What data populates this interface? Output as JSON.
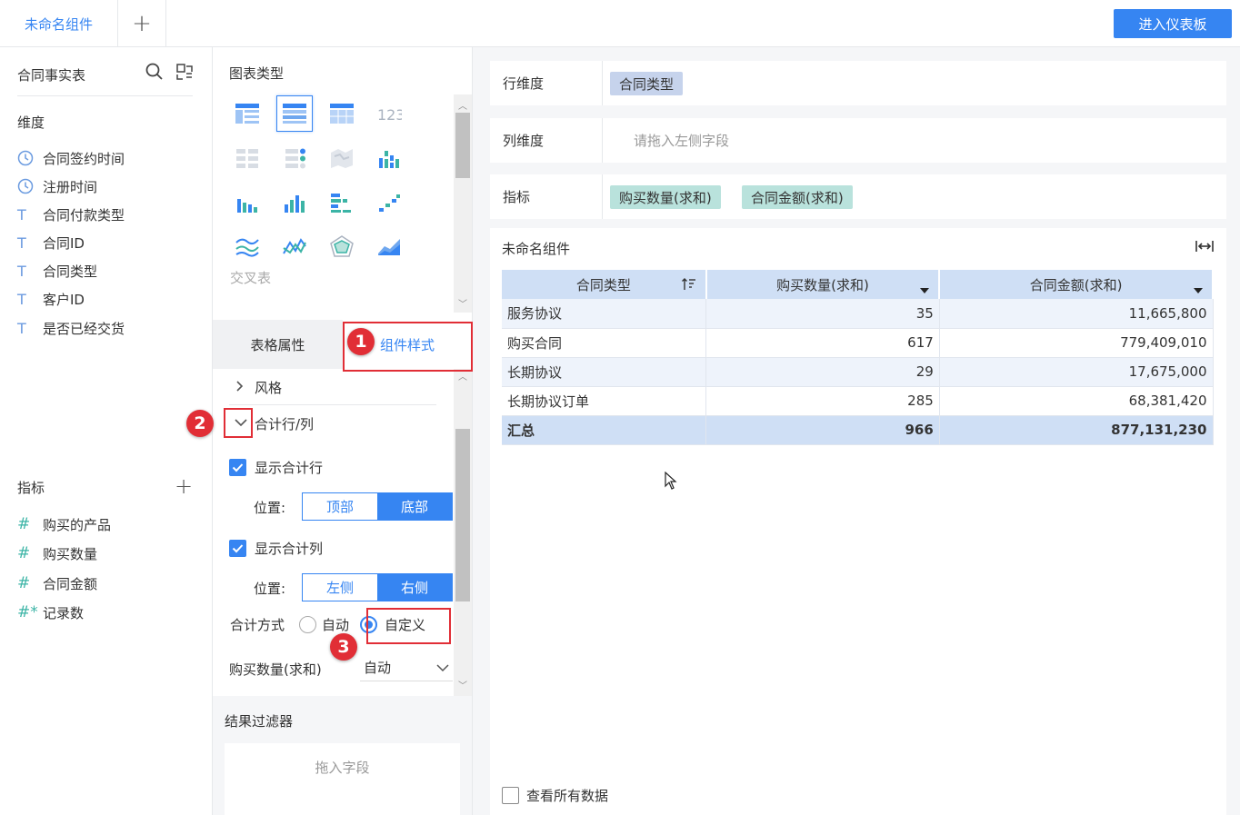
{
  "topbar": {
    "tab_label": "未命名组件",
    "add_tab": "+",
    "enter_dashboard": "进入仪表板"
  },
  "left": {
    "table_name": "合同事实表",
    "dimension_title": "维度",
    "dimensions": [
      {
        "icon": "clock-icon",
        "label": "合同签约时间"
      },
      {
        "icon": "clock-icon",
        "label": "注册时间"
      },
      {
        "icon": "text-icon",
        "label": "合同付款类型"
      },
      {
        "icon": "text-icon",
        "label": "合同ID"
      },
      {
        "icon": "text-icon",
        "label": "合同类型"
      },
      {
        "icon": "text-icon",
        "label": "客户ID"
      },
      {
        "icon": "text-icon",
        "label": "是否已经交货"
      }
    ],
    "metric_title": "指标",
    "metrics": [
      {
        "icon": "#",
        "label": "购买的产品"
      },
      {
        "icon": "#",
        "label": "购买数量"
      },
      {
        "icon": "#",
        "label": "合同金额"
      },
      {
        "icon": "#*",
        "label": "记录数"
      }
    ]
  },
  "middle": {
    "chart_type_title": "图表类型",
    "chart_type_selected_label": "交叉表",
    "tabs": {
      "table_props": "表格属性",
      "component_style": "组件样式"
    },
    "style_label": "风格",
    "subtotal_label": "合计行/列",
    "show_total_row": "显示合计行",
    "show_total_col": "显示合计列",
    "position_label": "位置:",
    "row_pos": {
      "top": "顶部",
      "bottom": "底部",
      "selected": "底部"
    },
    "col_pos": {
      "left": "左侧",
      "right": "右侧",
      "selected": "右侧"
    },
    "total_method_label": "合计方式",
    "method_auto": "自动",
    "method_custom": "自定义",
    "agg_field": "购买数量(求和)",
    "agg_value": "自动",
    "filter_title": "结果过滤器",
    "filter_placeholder": "拖入字段"
  },
  "annotations": {
    "b1": "1",
    "b2": "2",
    "b3": "3"
  },
  "right": {
    "row_dim_label": "行维度",
    "row_dim_pill": "合同类型",
    "col_dim_label": "列维度",
    "col_dim_placeholder": "请拖入左侧字段",
    "metric_label": "指标",
    "metric_pills": [
      "购买数量(求和)",
      "合同金额(求和)"
    ],
    "component_title": "未命名组件",
    "table": {
      "headers": [
        "合同类型",
        "购买数量(求和)",
        "合同金额(求和)"
      ],
      "rows": [
        [
          "服务协议",
          "35",
          "11,665,800"
        ],
        [
          "购买合同",
          "617",
          "779,409,010"
        ],
        [
          "长期协议",
          "29",
          "17,675,000"
        ],
        [
          "长期协议订单",
          "285",
          "68,381,420"
        ]
      ],
      "total": [
        "汇总",
        "966",
        "877,131,230"
      ]
    },
    "view_all": "查看所有数据"
  }
}
